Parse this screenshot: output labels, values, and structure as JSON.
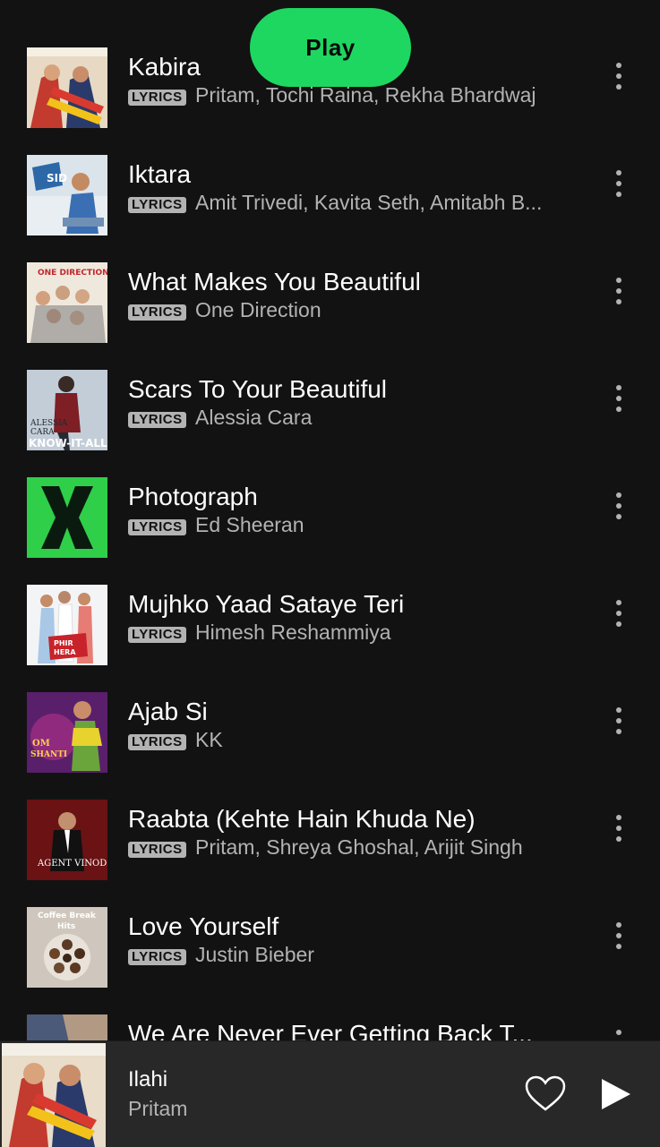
{
  "play_button": {
    "label": "Play"
  },
  "lyrics_badge": "LYRICS",
  "tracks": [
    {
      "title": "Kabira",
      "artist": "Pritam, Tochi Raina, Rekha Bhardwaj",
      "has_lyrics": true,
      "art_icon": "album-art-yeh-jawaani-hai-deewani"
    },
    {
      "title": "Iktara",
      "artist": "Amit Trivedi, Kavita Seth, Amitabh B...",
      "has_lyrics": true,
      "art_icon": "album-art-wake-up-sid"
    },
    {
      "title": "What Makes You Beautiful",
      "artist": "One Direction",
      "has_lyrics": true,
      "art_icon": "album-art-one-direction"
    },
    {
      "title": "Scars To Your Beautiful",
      "artist": "Alessia Cara",
      "has_lyrics": true,
      "art_icon": "album-art-know-it-all"
    },
    {
      "title": "Photograph",
      "artist": "Ed Sheeran",
      "has_lyrics": true,
      "art_icon": "album-art-x"
    },
    {
      "title": "Mujhko Yaad Sataye Teri",
      "artist": "Himesh Reshammiya",
      "has_lyrics": true,
      "art_icon": "album-art-phir-hera-pheri"
    },
    {
      "title": "Ajab Si",
      "artist": "KK",
      "has_lyrics": true,
      "art_icon": "album-art-om-shanti-om"
    },
    {
      "title": "Raabta (Kehte Hain Khuda Ne)",
      "artist": "Pritam, Shreya Ghoshal, Arijit Singh",
      "has_lyrics": true,
      "art_icon": "album-art-agent-vinod"
    },
    {
      "title": "Love Yourself",
      "artist": "Justin Bieber",
      "has_lyrics": true,
      "art_icon": "album-art-coffee-break-hits"
    },
    {
      "title": "We Are Never Ever Getting Back T...",
      "artist": "",
      "has_lyrics": false,
      "art_icon": "album-art-red"
    }
  ],
  "now_playing": {
    "title": "Ilahi",
    "artist": "Pritam",
    "art_icon": "album-art-yeh-jawaani-hai-deewani"
  },
  "colors": {
    "background": "#121212",
    "accent": "#1ed760",
    "secondary_text": "#b3b3b3",
    "mini_player": "#282828"
  }
}
